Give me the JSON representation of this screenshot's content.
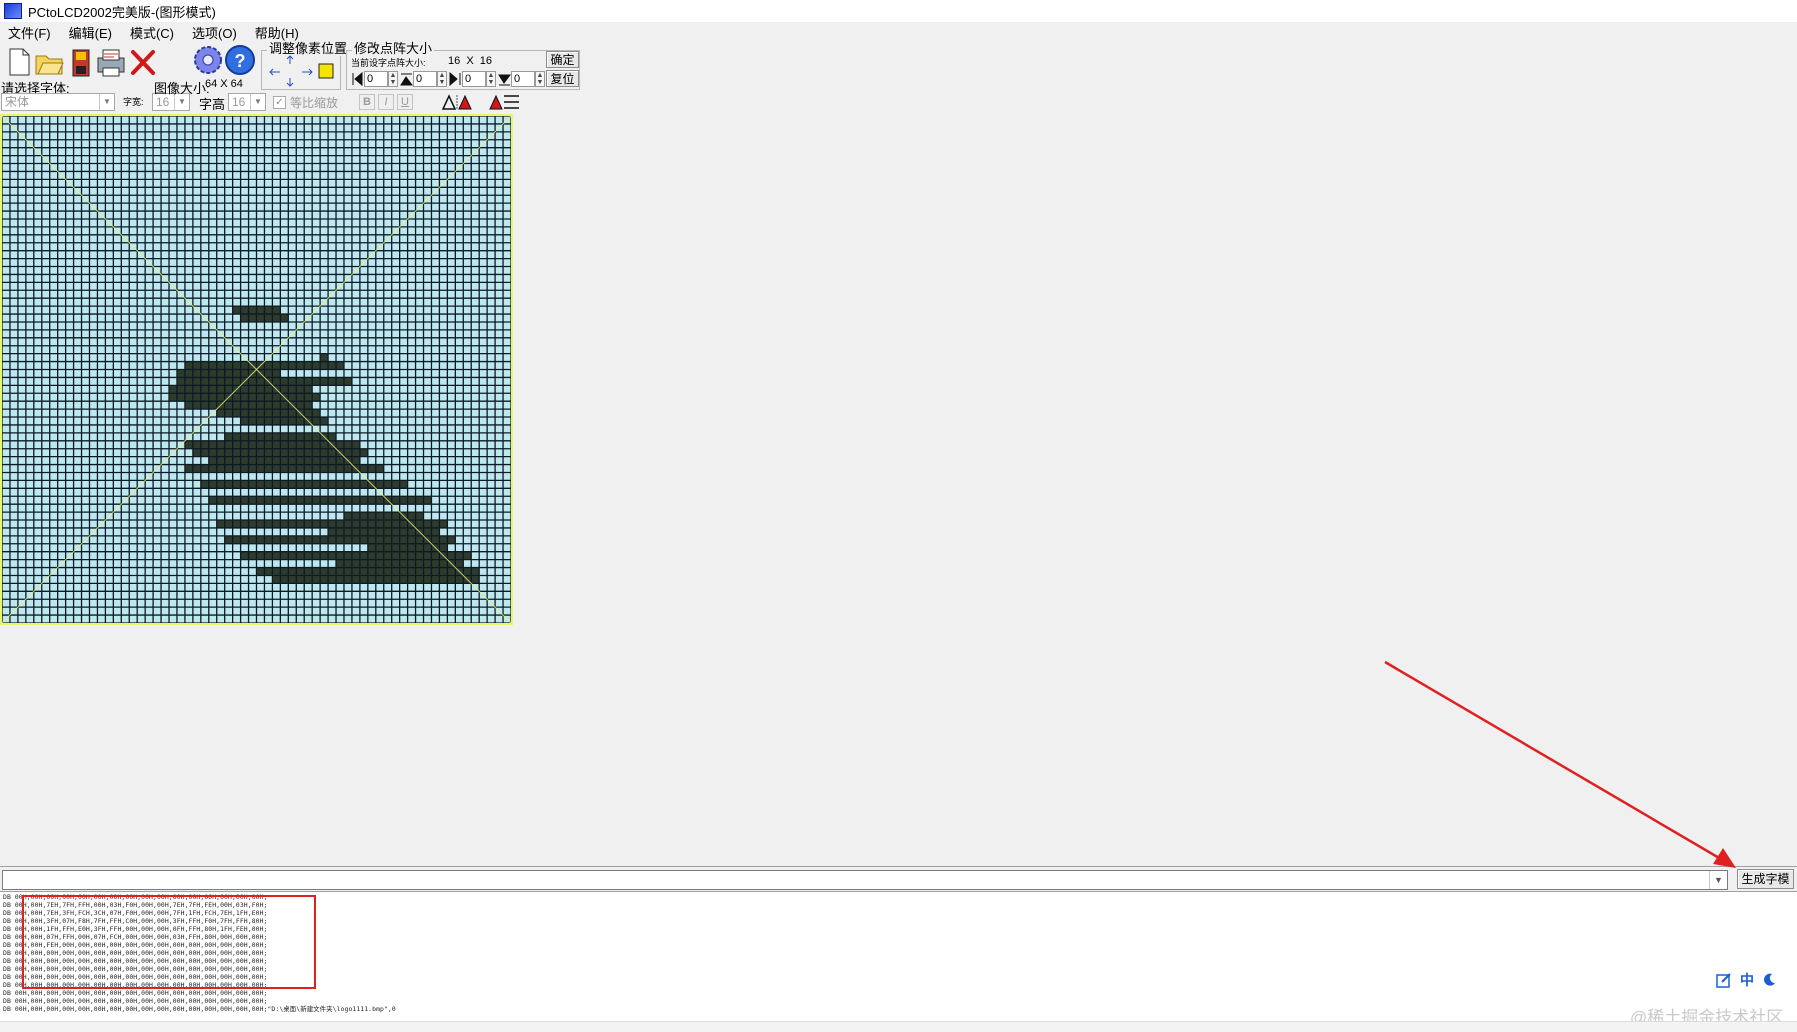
{
  "window": {
    "title": "PCtoLCD2002完美版-(图形模式)"
  },
  "menu": [
    {
      "label": "文件(F)"
    },
    {
      "label": "编辑(E)"
    },
    {
      "label": "模式(C)"
    },
    {
      "label": "选项(O)"
    },
    {
      "label": "帮助(H)"
    }
  ],
  "toolbar": {
    "icons": [
      "new-file-icon",
      "open-folder-icon",
      "save-icon",
      "print-icon",
      "delete-icon",
      "settings-gear-icon",
      "help-icon"
    ],
    "font_label": "请选择字体:",
    "font_value": "宋体",
    "char_width_label": "字宽:",
    "char_width_value": "16",
    "char_height_label": "字高",
    "char_height_value": "16",
    "image_size_label": "图像大小:",
    "image_size_value": "64 X 64",
    "proportional_label": "等比缩放",
    "proportional_checked": true,
    "bold_label": "B",
    "italic_label": "I",
    "underline_label": "U",
    "adjust_group_title": "调整像素位置",
    "resize_group_title": "修改点阵大小",
    "current_size_label": "当前设字点阵大小:",
    "current_size_value": "16  X  16",
    "spin_values": [
      "0",
      "0",
      "0",
      "0"
    ],
    "confirm_label": "确定",
    "reset_label": "复位"
  },
  "canvas": {
    "cols": 64,
    "rows": 64,
    "pixel_color": "#2e3a2b",
    "bg_color": "#bfe7ef",
    "grid_color": "#0b1b26",
    "pixels": [
      [
        5,
        16,
        6
      ],
      [
        8,
        15,
        9
      ],
      [
        4,
        17,
        10
      ],
      [
        4,
        18,
        12
      ],
      [
        11,
        18,
        2
      ],
      [
        12,
        19,
        3
      ],
      [
        13,
        20,
        4
      ],
      [
        14,
        21,
        5
      ],
      [
        14,
        22,
        6
      ],
      [
        15,
        23,
        7
      ],
      [
        15,
        24,
        8
      ],
      [
        16,
        25,
        9
      ],
      [
        16,
        26,
        10
      ],
      [
        17,
        27,
        11
      ],
      [
        17,
        28,
        12
      ],
      [
        17,
        29,
        13
      ],
      [
        18,
        30,
        14
      ],
      [
        18,
        31,
        15
      ],
      [
        18,
        32,
        16
      ],
      [
        19,
        33,
        17
      ],
      [
        19,
        34,
        18
      ],
      [
        20,
        35,
        19
      ],
      [
        21,
        36,
        20
      ],
      [
        22,
        37,
        21
      ],
      [
        23,
        38,
        22
      ],
      [
        24,
        39,
        24
      ],
      [
        25,
        40,
        26
      ],
      [
        26,
        38,
        27
      ],
      [
        27,
        37,
        29
      ],
      [
        28,
        36,
        30
      ],
      [
        29,
        35,
        31
      ],
      [
        30,
        34,
        32
      ],
      [
        31,
        33,
        33
      ],
      [
        32,
        32,
        34
      ],
      [
        33,
        31,
        35
      ],
      [
        34,
        30,
        36
      ],
      [
        35,
        29,
        37
      ],
      [
        36,
        28,
        38
      ],
      [
        37,
        27,
        39
      ],
      [
        32,
        22,
        34
      ],
      [
        34,
        21,
        38
      ],
      [
        35,
        21,
        39
      ],
      [
        33,
        22,
        40
      ],
      [
        31,
        23,
        41
      ],
      [
        31,
        25,
        42
      ],
      [
        33,
        25,
        43
      ],
      [
        24,
        29,
        34
      ],
      [
        25,
        30,
        35
      ],
      [
        28,
        40,
        34
      ],
      [
        29,
        39,
        37
      ],
      [
        30,
        40,
        40
      ],
      [
        41,
        23,
        44
      ],
      [
        44,
        23,
        47
      ],
      [
        42,
        24,
        45
      ],
      [
        46,
        25,
        50
      ],
      [
        48,
        26,
        53
      ],
      [
        51,
        27,
        55
      ],
      [
        53,
        28,
        56
      ],
      [
        55,
        30,
        58
      ],
      [
        57,
        32,
        59
      ],
      [
        58,
        34,
        59
      ],
      [
        58,
        36,
        59
      ],
      [
        58,
        38,
        59
      ],
      [
        57,
        40,
        58
      ],
      [
        56,
        42,
        57
      ],
      [
        55,
        44,
        56
      ],
      [
        54,
        46,
        55
      ],
      [
        52,
        48,
        54
      ],
      [
        50,
        49,
        52
      ],
      [
        48,
        50,
        50
      ],
      [
        46,
        50,
        48
      ],
      [
        44,
        49,
        46
      ],
      [
        42,
        48,
        44
      ],
      [
        41,
        46,
        43
      ],
      [
        40,
        44,
        42
      ],
      [
        39,
        42,
        41
      ],
      [
        38,
        40,
        40
      ],
      [
        37,
        38,
        39
      ],
      [
        37,
        36,
        38
      ],
      [
        36,
        34,
        37
      ],
      [
        37,
        32,
        38
      ],
      [
        38,
        30,
        39
      ],
      [
        40,
        28,
        41
      ],
      [
        42,
        27,
        43
      ],
      [
        43,
        26,
        44
      ],
      [
        34,
        23,
        36
      ],
      [
        35,
        24,
        37
      ],
      [
        36,
        23,
        38
      ],
      [
        22,
        41,
        24
      ],
      [
        23,
        42,
        26
      ],
      [
        24,
        43,
        28
      ],
      [
        25,
        44,
        30
      ],
      [
        26,
        45,
        32
      ],
      [
        27,
        46,
        33
      ],
      [
        28,
        46,
        35
      ],
      [
        29,
        47,
        36
      ],
      [
        31,
        47,
        37
      ],
      [
        33,
        46,
        36
      ],
      [
        35,
        45,
        35
      ],
      [
        21,
        50,
        22
      ],
      [
        22,
        51,
        24
      ],
      [
        24,
        52,
        26
      ],
      [
        26,
        53,
        28
      ],
      [
        28,
        54,
        30
      ],
      [
        29,
        55,
        31
      ],
      [
        30,
        56,
        31
      ],
      [
        31,
        57,
        32
      ],
      [
        32,
        56,
        33
      ],
      [
        33,
        55,
        34
      ],
      [
        34,
        54,
        35
      ],
      [
        26,
        46,
        30
      ],
      [
        27,
        47,
        31
      ],
      [
        28,
        48,
        32
      ],
      [
        29,
        49,
        33
      ],
      [
        30,
        50,
        32
      ],
      [
        31,
        51,
        32
      ],
      [
        48,
        45,
        51
      ],
      [
        50,
        43,
        52
      ],
      [
        52,
        41,
        53
      ]
    ]
  },
  "output": {
    "lines": [
      "DB 00H,00H,00H,00H,00H,00H,00H,00H,00H,00H,00H,00H,00H,00H,00H,00H;",
      "DB 00H,00H,7EH,7FH,FFH,00H,03H,F0H,00H,00H,7EH,7FH,FEH,00H,03H,F0H;",
      "DB 00H,00H,7EH,3FH,FCH,3CH,07H,F0H,00H,00H,7FH,1FH,FCH,7EH,1FH,E0H;",
      "DB 00H,00H,3FH,07H,F8H,7FH,FFH,C0H,00H,00H,3FH,FFH,F0H,7FH,FFH,80H;",
      "DB 00H,00H,1FH,FFH,E0H,3FH,FFH,00H,00H,00H,0FH,FFH,80H,1FH,FEH,00H;",
      "DB 00H,00H,07H,FFH,00H,07H,FCH,00H,00H,00H,03H,FFH,80H,00H,00H,00H;",
      "DB 00H,00H,FEH,00H,00H,00H,00H,00H,00H,00H,00H,00H,00H,00H,00H,00H;",
      "DB 00H,00H,00H,00H,00H,00H,00H,00H,00H,00H,00H,00H,00H,00H,00H,00H;",
      "DB 00H,00H,00H,00H,00H,00H,00H,00H,00H,00H,00H,00H,00H,00H,00H,00H;",
      "DB 00H,00H,00H,00H,00H,00H,00H,00H,00H,00H,00H,00H,00H,00H,00H,00H;",
      "DB 00H,00H,00H,00H,00H,00H,00H,00H,00H,00H,00H,00H,00H,00H,00H,00H;",
      "DB 00H,00H,00H,00H,00H,00H,00H,00H,00H,00H,00H,00H,00H,00H,00H,00H;",
      "DB 00H,00H,00H,00H,00H,00H,00H,00H,00H,00H,00H,00H,00H,00H,00H,00H;",
      "DB 00H,00H,00H,00H,00H,00H,00H,00H,00H,00H,00H,00H,00H,00H,00H,00H;",
      "DB 00H,00H,00H,00H,00H,00H,00H,00H,00H,00H,00H,00H,00H,00H,00H,00H;\"D:\\桌面\\新建文件夹\\logo1111.bmp\",0"
    ]
  },
  "generate_button": {
    "label": "生成字模"
  },
  "ime": {
    "lang_label": "中"
  },
  "watermark": "@稀土掘金技术社区"
}
